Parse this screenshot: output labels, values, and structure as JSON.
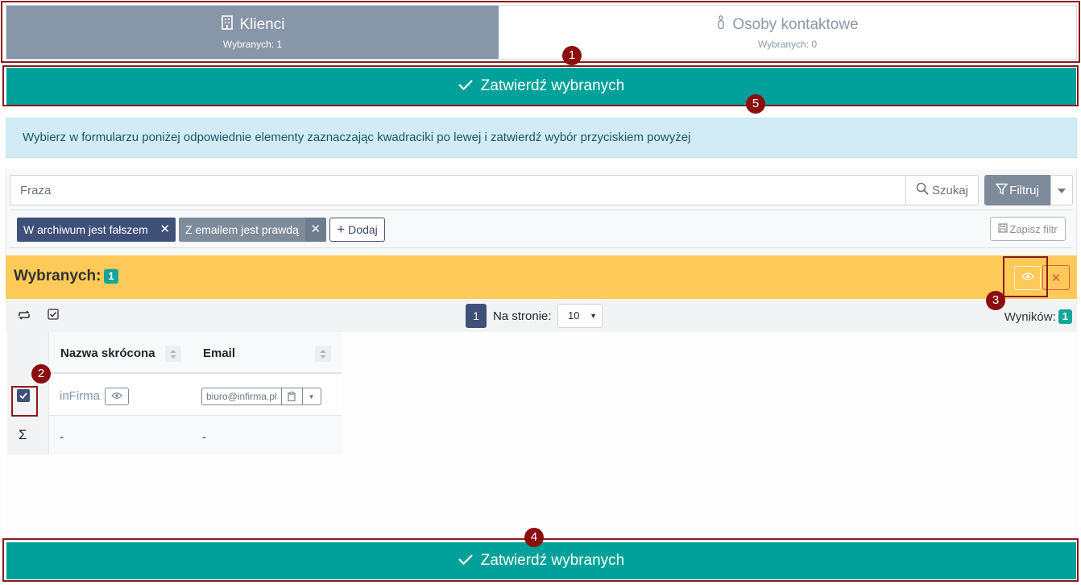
{
  "tabs": [
    {
      "title": "Klienci",
      "subtitle": "Wybranych: 1",
      "icon": "building-icon",
      "active": true
    },
    {
      "title": "Osoby kontaktowe",
      "subtitle": "Wybranych: 0",
      "icon": "person-icon",
      "active": false
    }
  ],
  "confirm": {
    "label": "Zatwierdź wybranych",
    "icon": "check-icon"
  },
  "info_text": "Wybierz w formularzu poniżej odpowiednie elementy zaznaczając kwadraciki po lewej i zatwierdź wybór przyciskiem powyżej",
  "search": {
    "placeholder": "Fraza",
    "value": "",
    "search_label": "Szukaj",
    "filter_label": "Filtruj"
  },
  "filters": {
    "chips": [
      {
        "label": "W archiwum jest fałszem",
        "color": "#3f5079"
      },
      {
        "label": "Z emailem jest prawdą",
        "color": "#7d8b9b"
      }
    ],
    "add_label": "Dodaj",
    "save_label": "Zapisz filtr"
  },
  "selection": {
    "label": "Wybranych:",
    "count": "1"
  },
  "pager": {
    "current_page": "1",
    "per_page_label": "Na stronie:",
    "per_page_value": "10",
    "results_label": "Wyników:",
    "results_count": "1"
  },
  "table": {
    "columns": [
      "Nazwa skrócona",
      "Email"
    ],
    "rows": [
      {
        "checked": true,
        "name": "inFirma",
        "email": "biuro@infirma.pl"
      }
    ],
    "summary": {
      "symbol": "Σ",
      "name": "-",
      "email": "-"
    }
  },
  "markers": [
    "1",
    "2",
    "3",
    "4",
    "5"
  ],
  "colors": {
    "accent": "#00a19a",
    "tab_active": "#8796a8",
    "primary": "#3f5079",
    "warning": "#fdca59",
    "info_bg": "#d1ecf4",
    "marker": "#8b0d0d"
  }
}
